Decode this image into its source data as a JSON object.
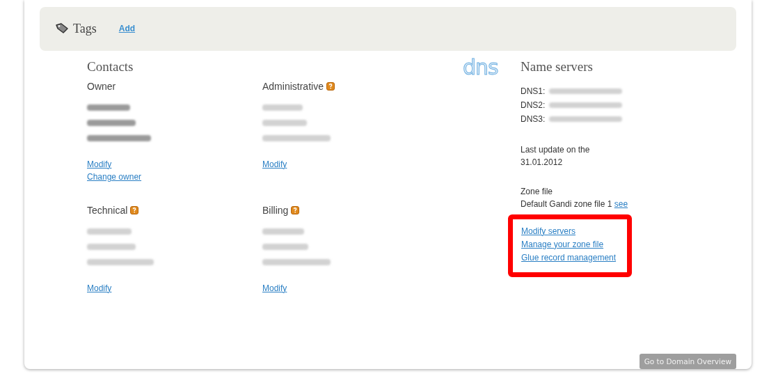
{
  "tags": {
    "title": "Tags",
    "add_link": "Add"
  },
  "contacts": {
    "title": "Contacts",
    "items": [
      {
        "label": "Owner",
        "help": false,
        "details": [
          {
            "redacted": true
          },
          {
            "redacted": true
          },
          {
            "redacted": true
          }
        ],
        "links": [
          "Modify",
          "Change owner"
        ]
      },
      {
        "label": "Administrative",
        "help": true,
        "details": [
          {
            "redacted": true
          },
          {
            "redacted": true
          },
          {
            "redacted": true
          }
        ],
        "links": [
          "Modify"
        ]
      },
      {
        "label": "Technical",
        "help": true,
        "details": [
          {
            "redacted": true
          },
          {
            "redacted": true
          },
          {
            "redacted": true
          }
        ],
        "links": [
          "Modify"
        ]
      },
      {
        "label": "Billing",
        "help": true,
        "details": [
          {
            "redacted": true
          },
          {
            "redacted": true
          },
          {
            "redacted": true
          }
        ],
        "links": [
          "Modify"
        ]
      }
    ]
  },
  "name_servers": {
    "logo": "dns",
    "title": "Name servers",
    "servers": [
      {
        "label": "DNS1:",
        "redacted": true
      },
      {
        "label": "DNS2:",
        "redacted": true
      },
      {
        "label": "DNS3:",
        "redacted": true
      }
    ],
    "last_update": [
      "Last update on the",
      "31.01.2012"
    ],
    "zone_file_label": "Zone file",
    "zone_file": "Default Gandi zone file 1",
    "zone_file_link": "see",
    "actions": [
      "Modify servers",
      "Manage your zone file",
      "Glue record management"
    ],
    "actions_highlighted": true
  },
  "overview_button": "Go to Domain Overview"
}
